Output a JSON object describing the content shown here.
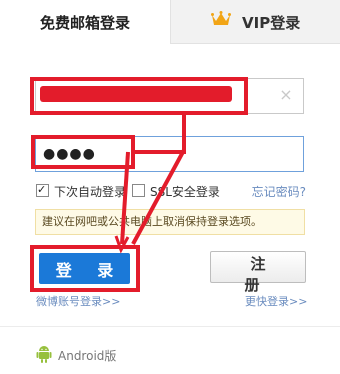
{
  "tabs": {
    "free_login": "免费邮箱登录",
    "vip_login": "VIP登录"
  },
  "form": {
    "username_value": "",
    "password_value": "●●●●",
    "clear_symbol": "×"
  },
  "options": {
    "auto_login": "下次自动登录",
    "ssl_login": "SSL安全登录",
    "forgot_password": "忘记密码?"
  },
  "tip": "建议在网吧或公共电脑上取消保持登录选项。",
  "buttons": {
    "login": "登 录",
    "register": "注 册"
  },
  "links": {
    "weibo_login": "微博账号登录>>",
    "more_login": "更快登录>>"
  },
  "footer": {
    "android": "Android版"
  },
  "colors": {
    "annotation_red": "#e31c2b",
    "login_blue": "#1b79d8",
    "link_blue": "#6a8cbf",
    "crown_gold": "#f2a516",
    "android_green": "#97c03d"
  }
}
